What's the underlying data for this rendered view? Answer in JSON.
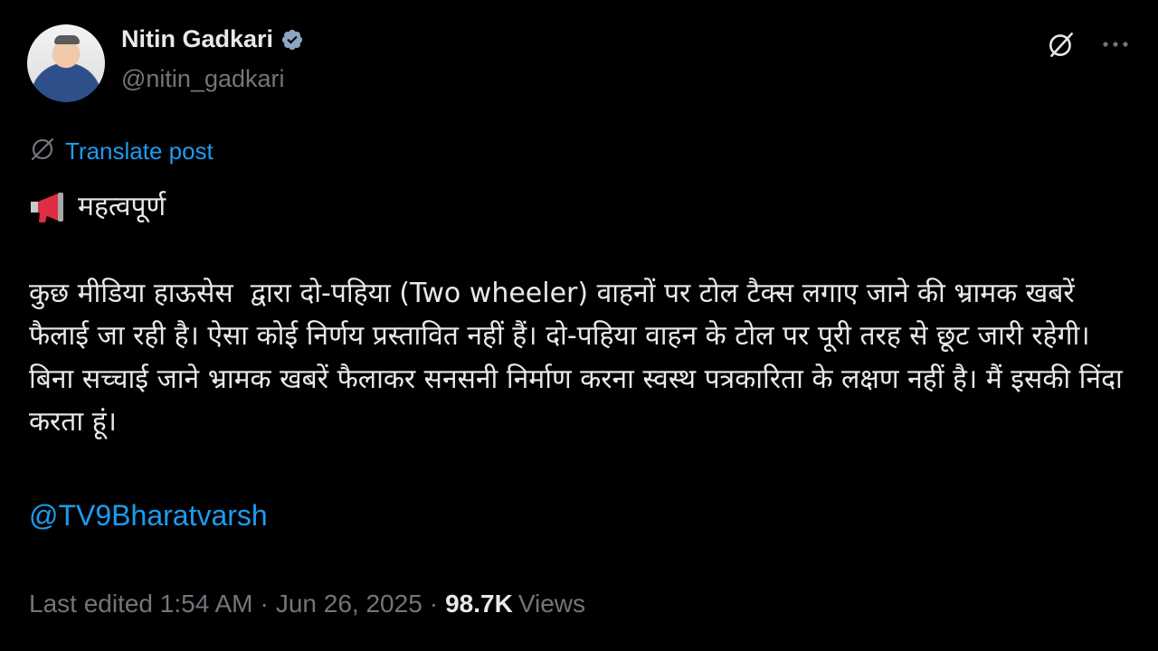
{
  "author": {
    "display_name": "Nitin Gadkari",
    "handle": "@nitin_gadkari",
    "verified": true,
    "verified_icon": "verified-badge-icon",
    "badge_color": "#8ba6c3"
  },
  "actions": {
    "grok_icon": "grok-icon",
    "more_icon": "more-icon"
  },
  "translate": {
    "icon": "translate-globe-icon",
    "label": "Translate post"
  },
  "post": {
    "heading_icon": "megaphone-icon",
    "heading": "महत्वपूर्ण",
    "paragraph": "कुछ मीडिया हाऊसेस  द्वारा दो-पहिया (Two wheeler) वाहनों पर टोल टैक्स लगाए जाने की भ्रामक खबरें फैलाई जा रही है। ऐसा कोई निर्णय प्रस्तावित नहीं हैं। दो-पहिया वाहन के टोल पर पूरी तरह से छूट जारी रहेगी। बिना सच्चाई जाने भ्रामक खबरें फैलाकर सनसनी निर्माण करना स्वस्थ पत्रकारिता के लक्षण नहीं है। मैं इसकी निंदा करता हूं।",
    "mention": "@TV9Bharatvarsh"
  },
  "meta": {
    "edited": "Last edited 1:54 AM",
    "date": "Jun 26, 2025",
    "views_count": "98.7K",
    "views_label": "Views",
    "separator": "·"
  },
  "colors": {
    "background": "#000000",
    "text": "#e7e9ea",
    "muted": "#71767b",
    "link": "#1d9bf0"
  }
}
